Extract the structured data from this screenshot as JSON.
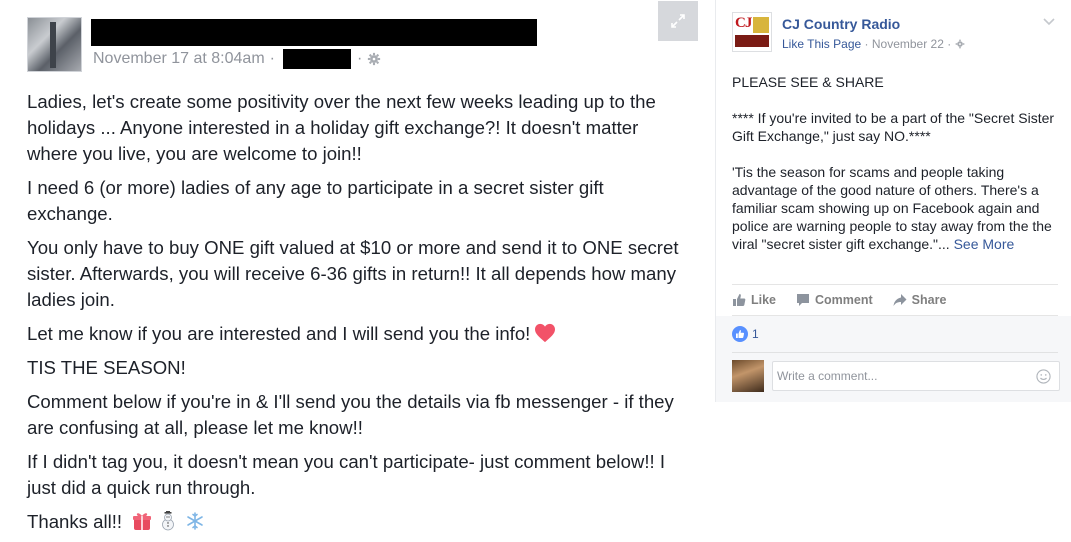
{
  "left_post": {
    "timestamp": "November 17 at 8:04am",
    "meta_separator": "·",
    "meta_separator2": "·",
    "paragraphs": [
      "Ladies, let's create some positivity over the next few weeks leading up to the holidays ... Anyone interested in a holiday gift exchange?! It doesn't matter where you live, you are welcome to join!!",
      "I need 6 (or more) ladies of any age to participate in a secret sister gift exchange.",
      "You only have to buy ONE gift valued at $10 or more and send it to ONE secret sister. Afterwards, you will receive 6-36 gifts in return!! It all depends how many ladies join.",
      "Let me know if you are interested and I will send you the info!",
      "TIS THE SEASON!",
      "Comment below if you're in & I'll send you the details via fb messenger - if they are confusing at all, please let me know!!",
      "If I didn't tag you, it doesn't mean you can't participate- just comment below!! I just did a quick run through.",
      "Thanks all!!"
    ],
    "icons": {
      "privacy": "gear-icon",
      "expand": "expand-icon",
      "heart": "heart-icon",
      "gift": "gift-icon",
      "snowman": "snowman-icon",
      "snowflake": "snowflake-icon"
    },
    "colors": {
      "heart": "#f25268",
      "text": "#1d2129",
      "meta": "#90949c"
    }
  },
  "right_post": {
    "page_name": "CJ Country Radio",
    "like_page": "Like This Page",
    "meta_separator": "·",
    "date": "November 22",
    "meta_separator2": "·",
    "heading": "PLEASE SEE & SHARE",
    "warning": "**** If you're invited to be a part of the \"Secret Sister Gift Exchange,\" just say NO.****",
    "body": "'Tis the season for scams and people taking advantage of the good nature of others. There's a familiar scam showing up on Facebook again and police are warning people to stay away from the the viral \"secret sister gift exchange.\"...",
    "see_more": "See More",
    "actions": {
      "like": "Like",
      "comment": "Comment",
      "share": "Share"
    },
    "reaction_count": "1",
    "comment_placeholder": "Write a comment...",
    "colors": {
      "link": "#365899",
      "reaction": "#5890ff"
    }
  }
}
